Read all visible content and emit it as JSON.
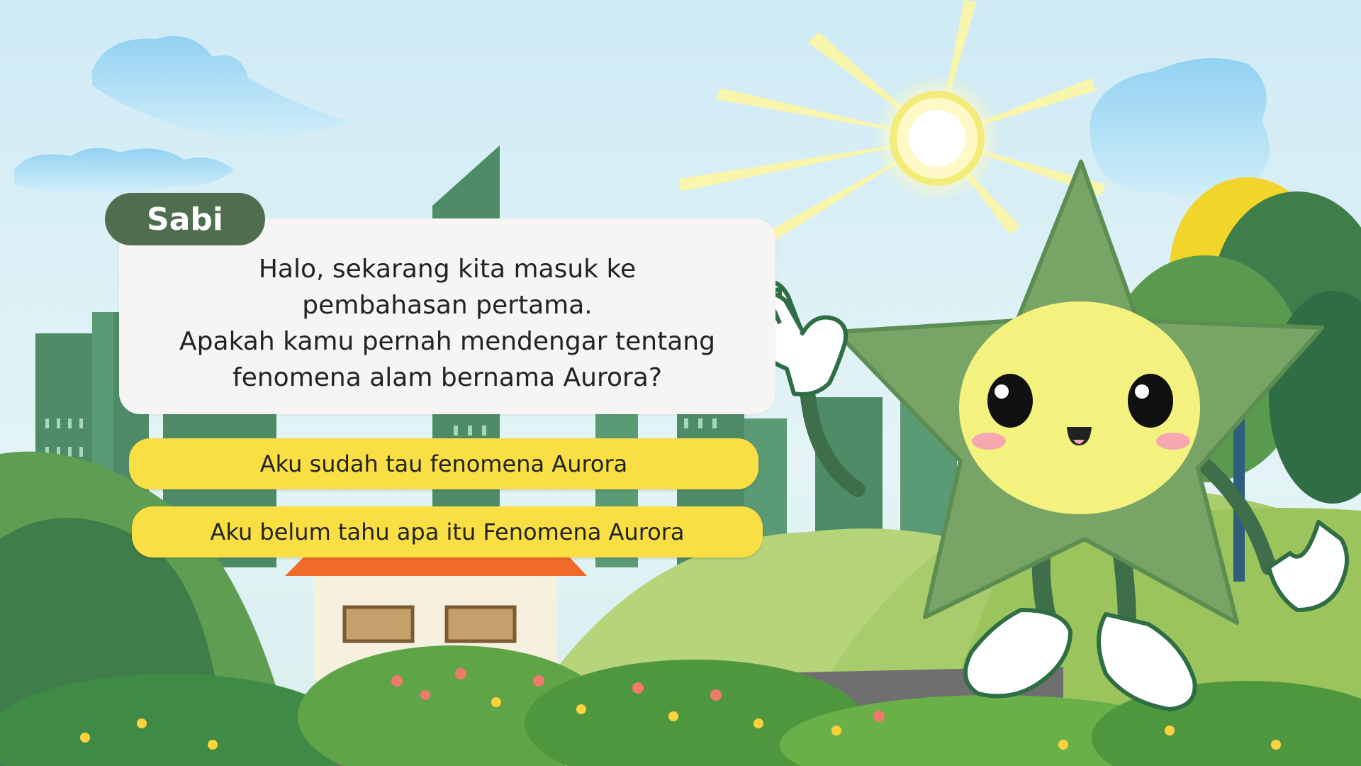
{
  "dialog": {
    "speaker": "Sabi",
    "lines": [
      "Halo,  sekarang kita masuk ke",
      "pembahasan pertama.",
      "Apakah kamu pernah mendengar tentang",
      "fenomena alam bernama Aurora?"
    ]
  },
  "choices": [
    {
      "label": "Aku sudah tau fenomena Aurora"
    },
    {
      "label": "Aku belum tahu apa itu Fenomena Aurora"
    }
  ],
  "scene": {
    "icons": [
      "sun-icon",
      "cloud-icon",
      "star-mascot",
      "house",
      "bushes",
      "flowers",
      "hills",
      "city-buildings"
    ],
    "colors": {
      "sky": "#d9f0f7",
      "building": "#4e8c68",
      "mascot": "#78a566",
      "mascot_face": "#f4f27e",
      "choice": "#f9df43",
      "tag": "#4f6e4f",
      "roof": "#f06a2a"
    }
  }
}
